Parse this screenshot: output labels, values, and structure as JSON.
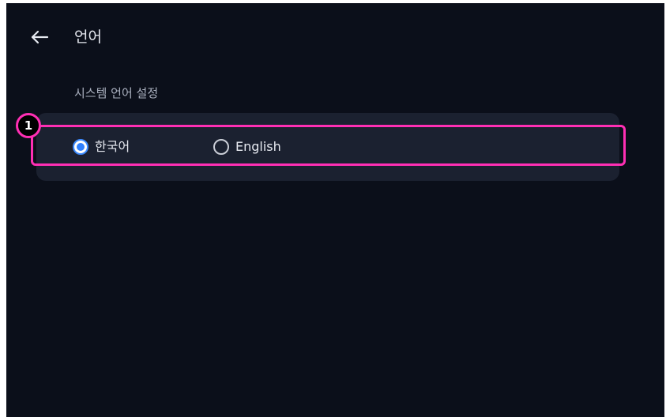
{
  "header": {
    "back_icon": "arrow-left-icon",
    "title": "언어"
  },
  "language": {
    "section_label": "시스템 언어 설정",
    "options": [
      {
        "label": "한국어",
        "selected": true
      },
      {
        "label": "English",
        "selected": false
      }
    ]
  },
  "annotation": {
    "marker_number": "1",
    "color": "#ff2fb4"
  },
  "colors": {
    "background": "#0b0f1a",
    "card": "#1b2130",
    "accent": "#2f80ff"
  }
}
